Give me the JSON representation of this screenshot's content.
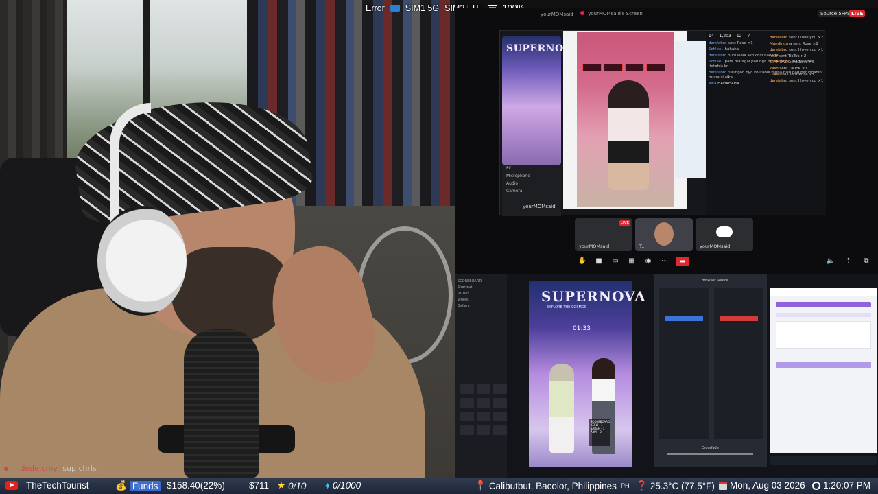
{
  "status_overlay": {
    "error": "Error",
    "sim1": "SIM1 5G",
    "sim2": "SIM2 LTE",
    "battery": "100%"
  },
  "share": {
    "owner_label": "yourMOMsaid's Screen",
    "owner_short": "yourMOMsaid",
    "quality": "Source 5FPS",
    "live": "LIVE",
    "tiktok_sidebar": [
      "PC",
      "Microphone",
      "Audio",
      "Camera"
    ],
    "stream_stats": [
      "14",
      "1,203",
      "12",
      "7"
    ],
    "chat_left": [
      {
        "user": "darsfabro",
        "text": "sent Rose ×1"
      },
      {
        "user": "Schlee..",
        "text": "hahaha"
      },
      {
        "user": "darsfabro",
        "text": "butil wala ako coin hahaha"
      },
      {
        "user": "Schlee..",
        "text": "para matagal pahinga mo lahat ng maglalabas itatabla ko"
      },
      {
        "user": "darsfabro",
        "text": "tulungan nyo ko itabla muna nisn pag pahingahin muna si aika"
      },
      {
        "user": "aika",
        "text": "HAHAHAHA"
      }
    ],
    "chat_right": [
      {
        "user": "darsfabro",
        "text": "sent I love you ×2"
      },
      {
        "user": "Mandingma",
        "text": "sent Rose ×2"
      },
      {
        "user": "darsfabro",
        "text": "sent I love you ×1"
      },
      {
        "user": "josh",
        "text": "sent TikTok ×2"
      },
      {
        "user": "DIAMOND",
        "text": "sent Rose ×3"
      },
      {
        "user": "kaso",
        "text": "sent TikTok ×1"
      },
      {
        "user": "DIAMOND",
        "text": "sent Rose ×1"
      },
      {
        "user": "darsfabro",
        "text": "sent I love you ×1"
      }
    ],
    "participants": [
      {
        "name": "yourMOMsaid",
        "live": "LIVE"
      },
      {
        "name": "T..."
      },
      {
        "name": "yourMOMsaid"
      }
    ]
  },
  "desktop": {
    "brand": "SUPERNOVA",
    "brand_sub": "EXPLORE THE COSMOS",
    "timer": "01:33",
    "scoreboard_title": "SCOREBOARD",
    "scoreboard_rows": [
      "KEELI - 1",
      "SARAH - 1",
      "AIKA - 0"
    ],
    "obs_title": "Browser Source",
    "crossfade": "Crossfade",
    "tt_sidebar": [
      "SCOREBOARD",
      "Shortcut",
      "PK Box",
      "Videos",
      "Gallery"
    ]
  },
  "chat_overlay": {
    "user": "dede.cmy",
    "message": "sup chris"
  },
  "bottom_bar": {
    "channel": "TheTechTourist",
    "funds_label": "Funds",
    "funds_amount": "$158.40(22%)",
    "goal_amount": "$711",
    "stars": "0/10",
    "gems": "0/1000",
    "location": "Calibutbut, Bacolor, Philippines",
    "country": "PH",
    "weather": "25.3°C (77.5°F)",
    "date": "Mon, Aug 03 2026",
    "time": "1:20:07 PM"
  }
}
